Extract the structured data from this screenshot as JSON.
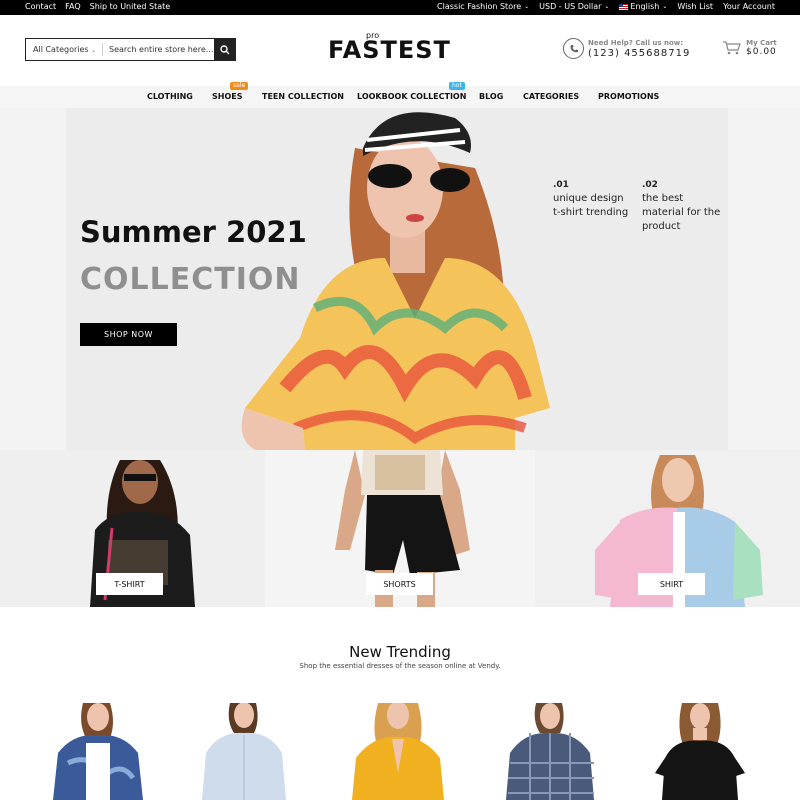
{
  "topbar": {
    "left_links": [
      "Contact",
      "FAQ",
      "Ship to United State"
    ],
    "store": "Classic Fashion Store",
    "currency": "USD - US Dollar",
    "language": "English",
    "wishlist": "Wish List",
    "account": "Your Account"
  },
  "search": {
    "category": "All Categories",
    "placeholder": "Search entire store here..."
  },
  "logo": {
    "pre": "pro",
    "text": "FASTEST"
  },
  "help": {
    "label": "Need Help? Call us now:",
    "phone": "(123) 455688719"
  },
  "cart": {
    "label": "My Cart",
    "amount": "$0.00"
  },
  "nav": {
    "items": [
      "CLOTHING",
      "SHOES",
      "TEEN COLLECTION",
      "LOOKBOOK COLLECTION",
      "BLOG",
      "CATEGORIES",
      "PROMOTIONS"
    ],
    "badge_sale": "sale",
    "badge_hot": "hot"
  },
  "hero": {
    "title": "Summer 2021",
    "subtitle": "COLLECTION",
    "cta": "SHOP NOW",
    "features": [
      {
        "num": ".01",
        "line1": "unique design",
        "line2": "t-shirt trending",
        "line3": ""
      },
      {
        "num": ".02",
        "line1": "the best",
        "line2": "material for the",
        "line3": "product"
      }
    ]
  },
  "categories": [
    "T-SHIRT",
    "SHORTS",
    "SHIRT"
  ],
  "trending": {
    "title": "New Trending",
    "subtitle": "Shop the essential dresses of the season online at Vendy."
  },
  "colors": {
    "accent_sale": "#f08c1c",
    "accent_hot": "#3ab6e8",
    "dark": "#000000"
  }
}
